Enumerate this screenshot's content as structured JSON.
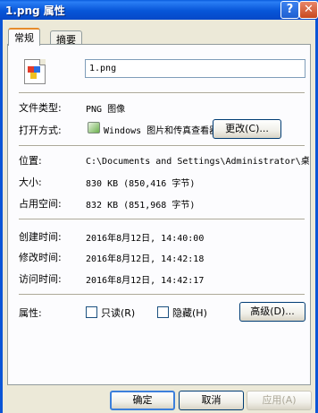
{
  "window": {
    "title": "1.png 属性",
    "help_glyph": "?",
    "close_glyph": "✕"
  },
  "tabs": [
    {
      "label": "常规",
      "active": true
    },
    {
      "label": "摘要",
      "active": false
    }
  ],
  "file": {
    "name": "1.png",
    "type_label": "文件类型:",
    "type_value": "PNG 图像",
    "opens_with_label": "打开方式:",
    "opens_with_value": "Windows 图片和传真查看器",
    "change_button": "更改(C)...",
    "location_label": "位置:",
    "location_value": "C:\\Documents and Settings\\Administrator\\桌面",
    "size_label": "大小:",
    "size_value": "830 KB (850,416 字节)",
    "size_on_disk_label": "占用空间:",
    "size_on_disk_value": "832 KB (851,968 字节)",
    "created_label": "创建时间:",
    "created_value": "2016年8月12日, 14:40:00",
    "modified_label": "修改时间:",
    "modified_value": "2016年8月12日, 14:42:18",
    "accessed_label": "访问时间:",
    "accessed_value": "2016年8月12日, 14:42:17"
  },
  "attributes": {
    "label": "属性:",
    "readonly_label": "只读(R)",
    "readonly_checked": false,
    "hidden_label": "隐藏(H)",
    "hidden_checked": false,
    "advanced_button": "高级(D)..."
  },
  "footer": {
    "ok_button": "确定",
    "cancel_button": "取消",
    "apply_button": "应用(A)",
    "apply_enabled": false
  }
}
